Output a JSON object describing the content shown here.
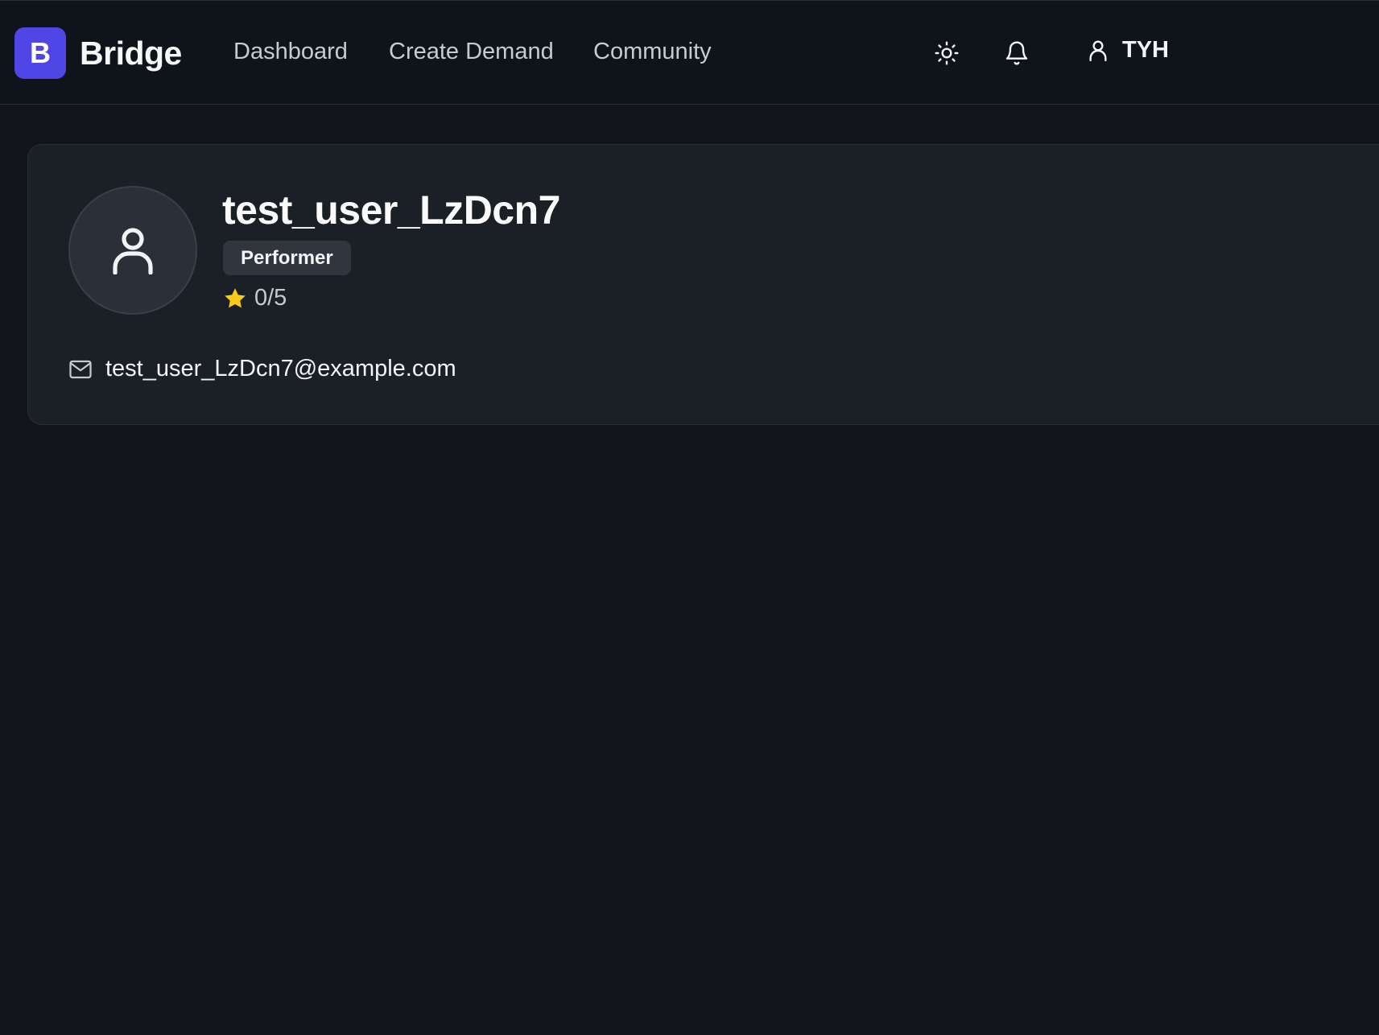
{
  "header": {
    "logo_letter": "B",
    "brand": "Bridge",
    "nav": [
      {
        "label": "Dashboard"
      },
      {
        "label": "Create Demand"
      },
      {
        "label": "Community"
      }
    ],
    "icons": {
      "theme": "sun-icon",
      "notifications": "bell-icon",
      "user": "user-icon"
    },
    "user_initials": "TYH"
  },
  "profile": {
    "username": "test_user_LzDcn7",
    "role_badge": "Performer",
    "rating": "0/5",
    "email": "test_user_LzDcn7@example.com"
  },
  "colors": {
    "background": "#111419",
    "card": "#1b1f26",
    "accent": "#4f46e5",
    "star": "#facc15"
  }
}
